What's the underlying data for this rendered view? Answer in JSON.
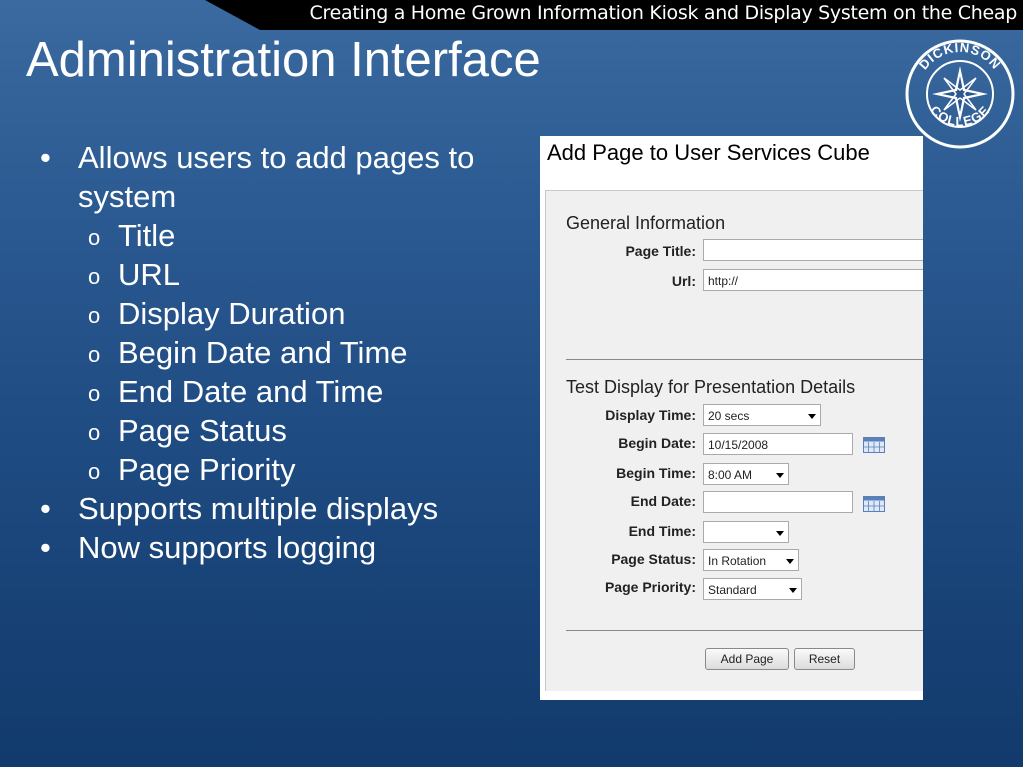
{
  "banner": {
    "text": "Creating a Home Grown Information Kiosk and Display System on the Cheap"
  },
  "slide": {
    "title": "Administration Interface",
    "bullets": [
      {
        "text": "Allows users to add pages to system"
      },
      {
        "text": "Supports multiple displays"
      },
      {
        "text": "Now supports logging"
      }
    ],
    "sub_bullets": [
      "Title",
      "URL",
      "Display Duration",
      "Begin Date and Time",
      "End Date and Time",
      "Page Status",
      "Page Priority"
    ]
  },
  "logo": {
    "text_top": "DICKINSON",
    "text_bottom": "COLLEGE"
  },
  "form": {
    "title": "Add Page to User Services Cube",
    "general_heading": "General Information",
    "page_title_label": "Page Title:",
    "page_title_value": "",
    "url_label": "Url:",
    "url_value": "http://",
    "test_heading": "Test Display for Presentation Details",
    "display_time_label": "Display Time:",
    "display_time_value": "20 secs",
    "begin_date_label": "Begin Date:",
    "begin_date_value": "10/15/2008",
    "begin_time_label": "Begin Time:",
    "begin_time_value": "8:00 AM",
    "end_date_label": "End Date:",
    "end_date_value": "",
    "end_time_label": "End Time:",
    "end_time_value": "",
    "page_status_label": "Page Status:",
    "page_status_value": "In Rotation",
    "page_priority_label": "Page Priority:",
    "page_priority_value": "Standard",
    "add_page_button": "Add Page",
    "reset_button": "Reset"
  },
  "colors": {
    "background": "#1d4a80",
    "banner": "#000000",
    "panel": "#ffffff",
    "form_bg": "#f0f0f0"
  }
}
